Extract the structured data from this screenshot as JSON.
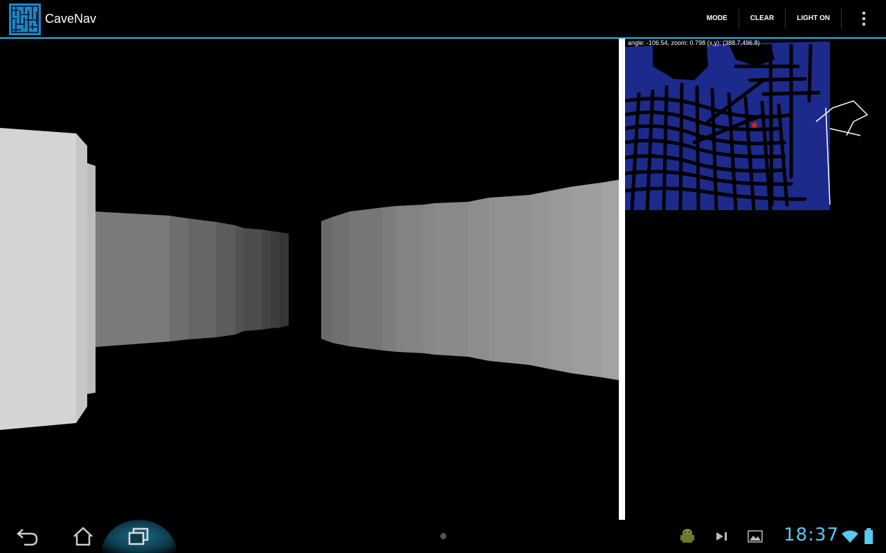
{
  "app": {
    "title": "CaveNav",
    "icon": "maze-icon"
  },
  "actions": {
    "mode_label": "MODE",
    "clear_label": "CLEAR",
    "light_label": "LIGHT ON",
    "overflow_icon": "overflow-menu-icon"
  },
  "map": {
    "info": "angle: -106.54, zoom: 0.798 (x,y): (388.7,496.8)",
    "water_color": "#1c2a8c",
    "rock_color": "#000000",
    "player_color": "#d02020"
  },
  "nav": {
    "back_icon": "back-icon",
    "home_icon": "home-icon",
    "recents_icon": "recents-icon",
    "clock": "18:37",
    "status_icons": [
      "android-icon",
      "media-next-icon",
      "gallery-icon",
      "wifi-icon",
      "battery-icon"
    ]
  },
  "colors": {
    "accent": "#33b5e5",
    "clock": "#5ac8ef"
  }
}
